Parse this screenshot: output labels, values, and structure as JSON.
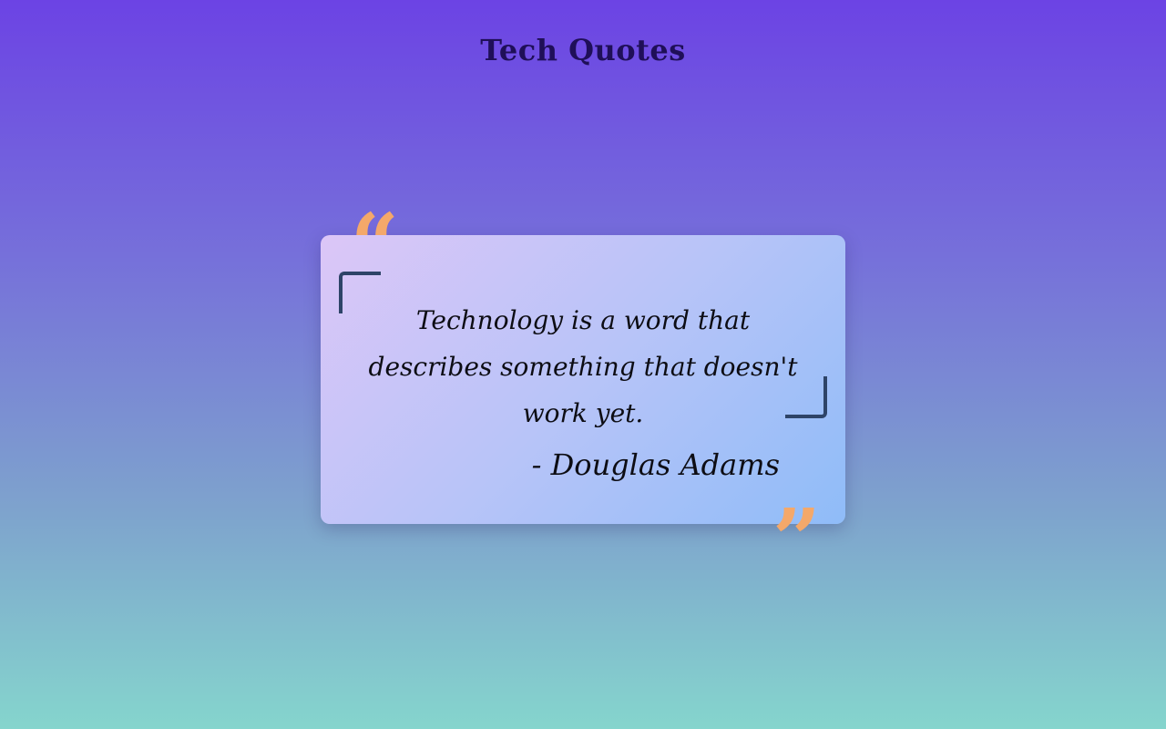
{
  "header": {
    "title": "Tech Quotes"
  },
  "quote": {
    "text": "Technology is a word that describes something that doesn't work yet.",
    "author": "- Douglas Adams",
    "open_mark_icon": "opening-quote-icon",
    "close_mark_icon": "closing-quote-icon"
  },
  "colors": {
    "background_top": "#6c43e4",
    "background_bottom": "#85d5cd",
    "title": "#1f0f58",
    "quote_marks": "#f4a86a",
    "corner_brackets": "#2e4468",
    "card_left": "#dcc6f7",
    "card_right": "#8fbcf8"
  }
}
